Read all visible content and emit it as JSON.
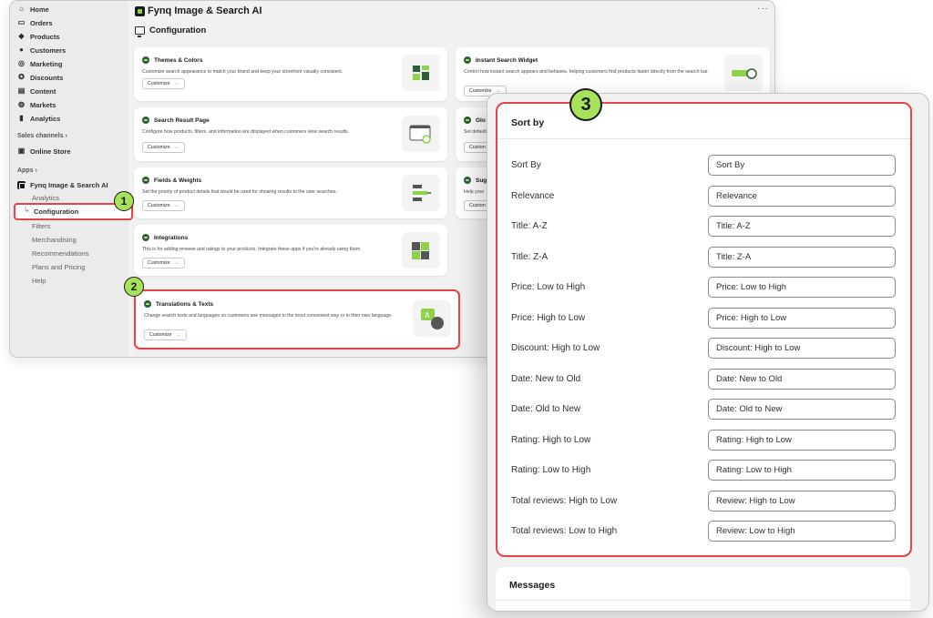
{
  "sidebar": {
    "items": [
      {
        "label": "Home",
        "icon": "home-icon",
        "glyph": "⌂"
      },
      {
        "label": "Orders",
        "icon": "inbox-icon",
        "glyph": "▭"
      },
      {
        "label": "Products",
        "icon": "tag-icon",
        "glyph": "◆"
      },
      {
        "label": "Customers",
        "icon": "person-icon",
        "glyph": "●"
      },
      {
        "label": "Marketing",
        "icon": "target-icon",
        "glyph": "◎"
      },
      {
        "label": "Discounts",
        "icon": "discount-icon",
        "glyph": "✪"
      },
      {
        "label": "Content",
        "icon": "content-icon",
        "glyph": "▤"
      },
      {
        "label": "Markets",
        "icon": "globe-icon",
        "glyph": "◍"
      },
      {
        "label": "Analytics",
        "icon": "bar-chart-icon",
        "glyph": "▮"
      }
    ],
    "sales_channels": "Sales channels",
    "online_store": "Online Store",
    "apps": "Apps",
    "app_name": "Fynq Image & Search AI",
    "sub_items": {
      "analytics": "Analytics",
      "configuration": "Configuration",
      "filters": "Filters",
      "merchandising": "Merchandising",
      "recommendations": "Recommendations",
      "plans": "Plans and Pricing",
      "help": "Help"
    }
  },
  "header": {
    "app_title": "Fynq Image & Search AI",
    "page_title": "Configuration"
  },
  "cards": {
    "themes": {
      "title": "Themes & Colors",
      "desc": "Customize search appearance to match your brand and keep your storefront visually consistent.",
      "button": "Customize"
    },
    "instant": {
      "title": "Instant Search Widget",
      "desc": "Control how instant search appears and behaves, helping customers find products faster directly from the search bar.",
      "button": "Customize"
    },
    "result_page": {
      "title": "Search Result Page",
      "desc": "Configure how products, filters, and information are displayed when customers view search results.",
      "button": "Customize"
    },
    "fields": {
      "title": "Fields & Weights",
      "desc": "Set the priority of product details that would be used for showing results to the user searches.",
      "button": "Customize"
    },
    "integrations": {
      "title": "Integrations",
      "desc": "This is for adding reviews and ratings to your products. Integrate these apps if you're already using them",
      "button": "Customize"
    },
    "translations": {
      "title": "Translations & Texts",
      "desc": "Change search texts and languages so customers see messages in the most convenient way or in their own language.",
      "button": "Customize"
    },
    "partial_1": {
      "title": "Glo",
      "desc": "Set default",
      "button": "Custom"
    },
    "partial_2": {
      "title": "Sugg",
      "desc": "Help your",
      "button": "Custom"
    }
  },
  "badges": {
    "one": "1",
    "two": "2",
    "three": "3"
  },
  "sort_panel": {
    "title": "Sort by",
    "rows": [
      {
        "label": "Sort By",
        "value": "Sort By"
      },
      {
        "label": "Relevance",
        "value": "Relevance"
      },
      {
        "label": "Title: A-Z",
        "value": "Title: A-Z"
      },
      {
        "label": "Title: Z-A",
        "value": "Title: Z-A"
      },
      {
        "label": "Price: Low to High",
        "value": "Price: Low to High"
      },
      {
        "label": "Price: High to Low",
        "value": "Price: High to Low"
      },
      {
        "label": "Discount: High to Low",
        "value": "Discount: High to Low"
      },
      {
        "label": "Date: New to Old",
        "value": "Date: New to Old"
      },
      {
        "label": "Date: Old to New",
        "value": "Date: Old to New"
      },
      {
        "label": "Rating: High to Low",
        "value": "Rating: High to Low"
      },
      {
        "label": "Rating: Low to High",
        "value": "Rating: Low to High"
      },
      {
        "label": "Total reviews: High to Low",
        "value": "Review: High to Low"
      },
      {
        "label": "Total reviews: Low to High",
        "value": "Review: Low to High"
      }
    ]
  },
  "messages_panel": {
    "title": "Messages"
  },
  "colors": {
    "accent_green": "#a6e35a",
    "highlight_red": "#e8424a",
    "dark_green": "#2f5d3a"
  }
}
